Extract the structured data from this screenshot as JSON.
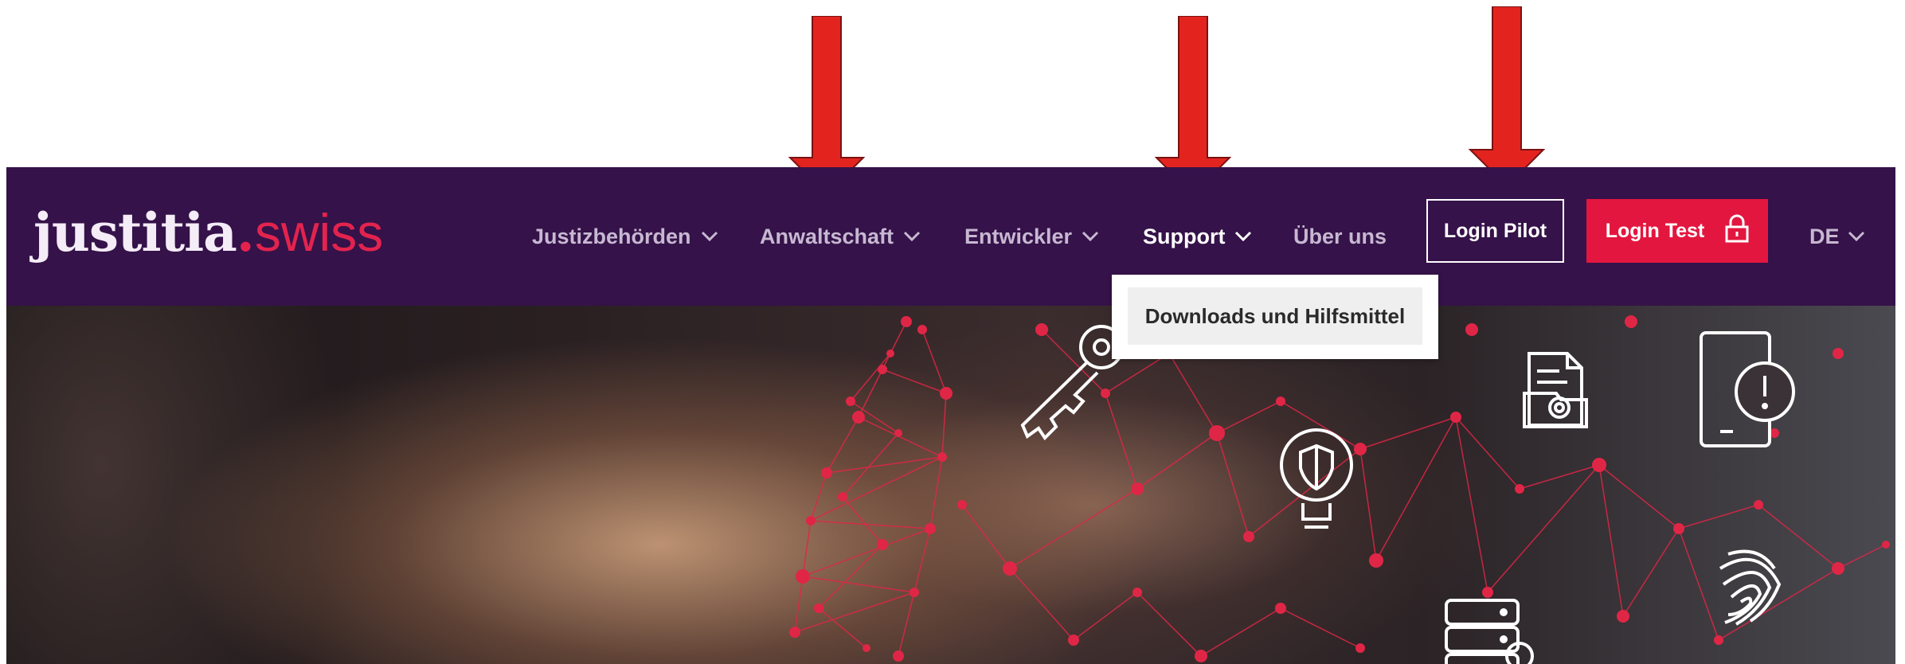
{
  "logo": {
    "part1": "justitia",
    "dot": ".",
    "part2": "swiss"
  },
  "nav": {
    "items": [
      {
        "label": "Justizbehörden",
        "has_menu": true
      },
      {
        "label": "Anwaltschaft",
        "has_menu": true
      },
      {
        "label": "Entwickler",
        "has_menu": true
      },
      {
        "label": "Support",
        "has_menu": true,
        "active": true
      },
      {
        "label": "Über uns",
        "has_menu": false
      }
    ],
    "login_pilot": "Login Pilot",
    "login_test": "Login Test",
    "language": "DE"
  },
  "dropdown": {
    "items": [
      {
        "label": "Downloads und Hilfsmittel"
      }
    ]
  },
  "hero_icons": [
    "key-icon",
    "shield-bulb-icon",
    "document-gear-icon",
    "phone-alert-icon",
    "fingerprint-icon",
    "server-gear-icon"
  ],
  "annotation": {
    "arrow_count": 3
  },
  "colors": {
    "nav_bg": "#351249",
    "accent": "#e3163f",
    "nav_text": "#c7b8d2",
    "arrow": "#e3241e"
  }
}
